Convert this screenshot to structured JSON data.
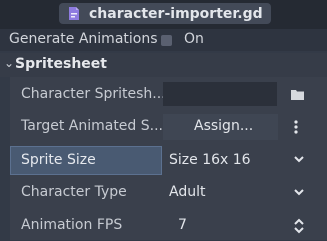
{
  "header": {
    "title": "character-importer.gd",
    "icon": "script-file-icon"
  },
  "generate_animations": {
    "label": "Generate Animations",
    "checked": false,
    "state_label": "On"
  },
  "section": {
    "label": "Spritesheet",
    "expanded": true
  },
  "properties": {
    "character_spritesheet": {
      "label": "Character Spritesh...",
      "value": ""
    },
    "target_animated_sprite": {
      "label": "Target Animated S...",
      "button_label": "Assign..."
    },
    "sprite_size": {
      "label": "Sprite Size",
      "value": "Size 16x 16"
    },
    "character_type": {
      "label": "Character Type",
      "value": "Adult"
    },
    "animation_fps": {
      "label": "Animation FPS",
      "value": "7"
    }
  },
  "colors": {
    "accent": "#495a72",
    "icon_purple": "#8e7be0"
  }
}
